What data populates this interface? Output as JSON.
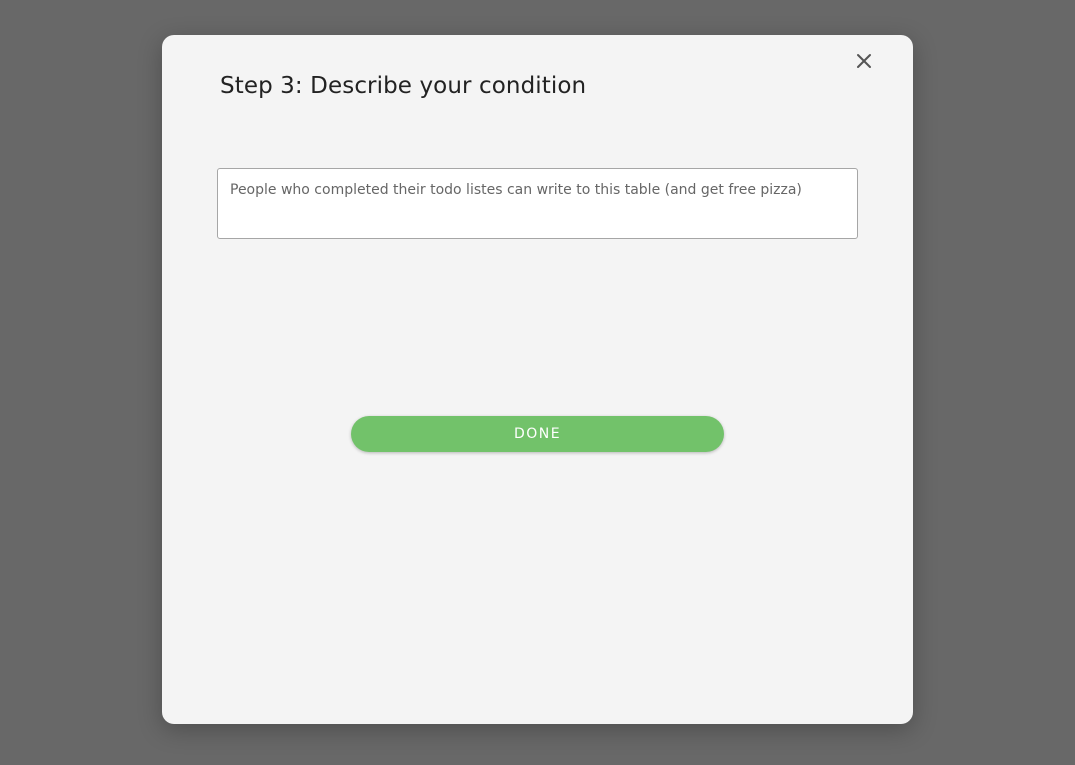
{
  "dialog": {
    "title": "Step 3: Describe your condition",
    "close_icon": "close-icon",
    "condition_input": {
      "value": "",
      "placeholder": "People who completed their todo listes can write to this table (and get free pizza)"
    },
    "done_label": "DONE"
  },
  "colors": {
    "backdrop": "#686868",
    "modal_background": "#f4f4f4",
    "done_button": "#72c26a",
    "done_text": "#ffffff"
  }
}
